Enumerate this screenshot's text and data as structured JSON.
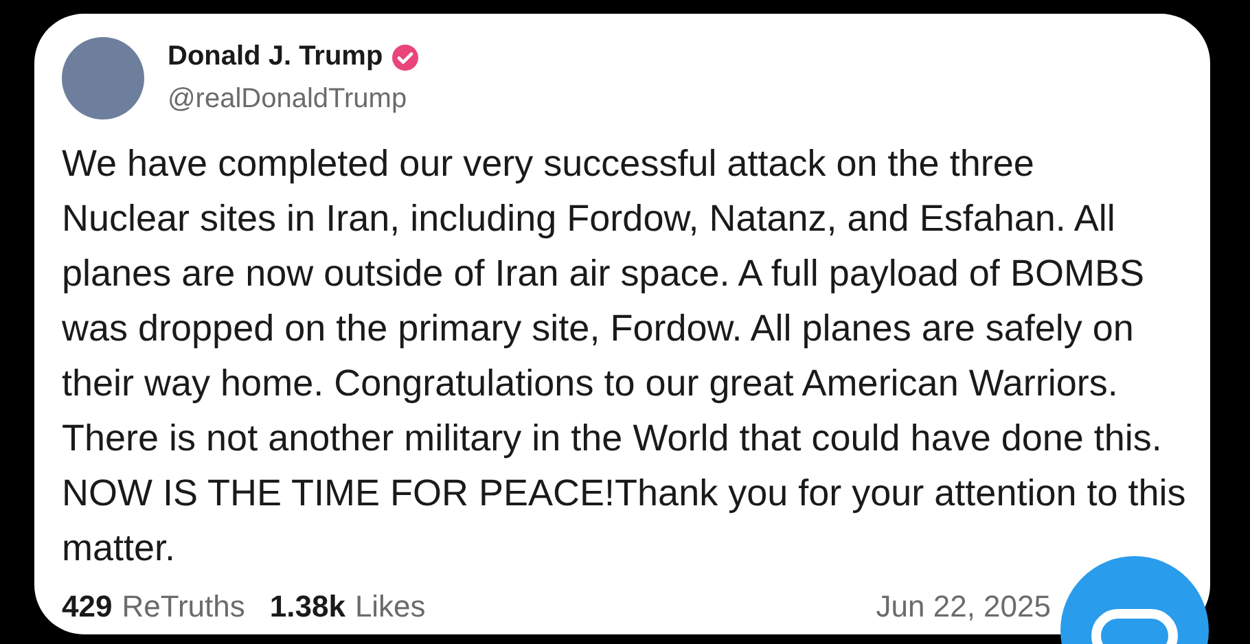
{
  "post": {
    "author": {
      "name": "Donald J. Trump",
      "verified": true,
      "handle": "@realDonaldTrump"
    },
    "body": "We have completed our very successful attack on the three\nNuclear sites in Iran, including Fordow, Natanz, and Esfahan. All\nplanes are now outside of Iran air space. A full payload of BOMBS\nwas dropped on the primary site, Fordow. All planes are safely on\ntheir way home. Congratulations to our great American Warriors.\nThere is not another military in the World that could have done this.\nNOW IS THE TIME FOR PEACE!Thank you for your attention to this\nmatter.",
    "stats": [
      {
        "count": "429",
        "label": "ReTruths"
      },
      {
        "count": "1.38k",
        "label": "Likes"
      }
    ],
    "date": "Jun 22, 2025"
  }
}
